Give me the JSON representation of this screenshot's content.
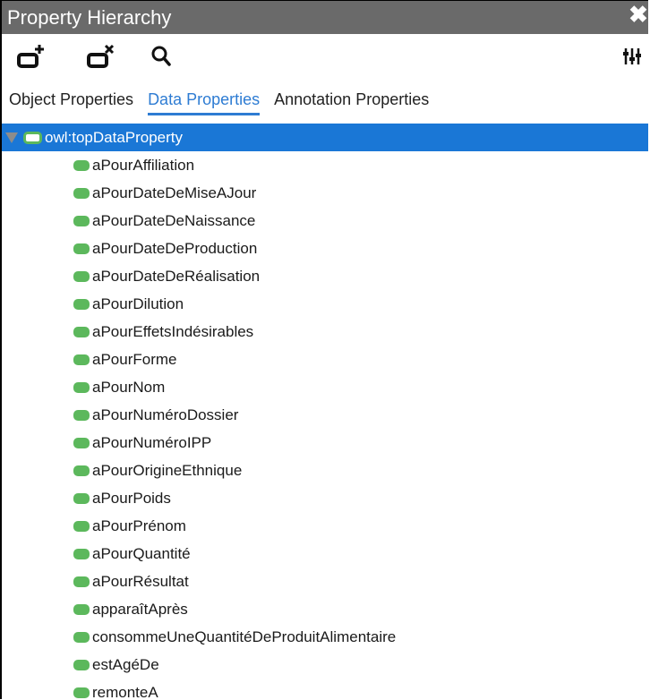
{
  "window": {
    "title": "Property Hierarchy",
    "close_glyph": "✖"
  },
  "toolbar": {
    "add_subproperty_icon": "add-subproperty-icon",
    "delete_property_icon": "delete-property-icon",
    "search_icon": "search-icon",
    "options_icon": "options-icon"
  },
  "tabs": [
    {
      "label": "Object Properties"
    },
    {
      "label": "Data Properties"
    },
    {
      "label": "Annotation Properties"
    }
  ],
  "tree": {
    "root": {
      "label": "owl:topDataProperty"
    },
    "children": [
      {
        "label": "aPourAffiliation"
      },
      {
        "label": "aPourDateDeMiseAJour"
      },
      {
        "label": "aPourDateDeNaissance"
      },
      {
        "label": "aPourDateDeProduction"
      },
      {
        "label": "aPourDateDeRéalisation"
      },
      {
        "label": "aPourDilution"
      },
      {
        "label": "aPourEffetsIndésirables"
      },
      {
        "label": "aPourForme"
      },
      {
        "label": "aPourNom"
      },
      {
        "label": "aPourNuméroDossier"
      },
      {
        "label": "aPourNuméroIPP"
      },
      {
        "label": "aPourOrigineEthnique"
      },
      {
        "label": "aPourPoids"
      },
      {
        "label": "aPourPrénom"
      },
      {
        "label": "aPourQuantité"
      },
      {
        "label": "aPourRésultat"
      },
      {
        "label": "apparaîtAprès"
      },
      {
        "label": "consommeUneQuantitéDeProduitAlimentaire"
      },
      {
        "label": "estAgéDe"
      },
      {
        "label": "remonteA"
      }
    ]
  },
  "colors": {
    "titlebar": "#6a6a6a",
    "selection": "#1a77d6",
    "active_tab": "#2e7cd3",
    "data_property_icon": "#5cb85c"
  }
}
